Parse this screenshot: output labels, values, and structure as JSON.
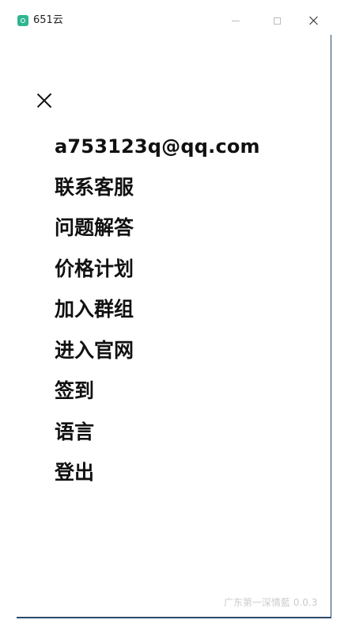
{
  "titlebar": {
    "icon": "app-leaf-icon",
    "title": "651云",
    "accent_color": "#2fb58f"
  },
  "menu": {
    "close_icon": "close-icon",
    "items": [
      {
        "label": "a753123q@qq.com"
      },
      {
        "label": "联系客服"
      },
      {
        "label": "问题解答"
      },
      {
        "label": "价格计划"
      },
      {
        "label": "加入群组"
      },
      {
        "label": "进入官网"
      },
      {
        "label": "签到"
      },
      {
        "label": "语言"
      },
      {
        "label": "登出"
      }
    ]
  },
  "footer": {
    "version_text": "广东第一深情藍 0.0.3"
  }
}
